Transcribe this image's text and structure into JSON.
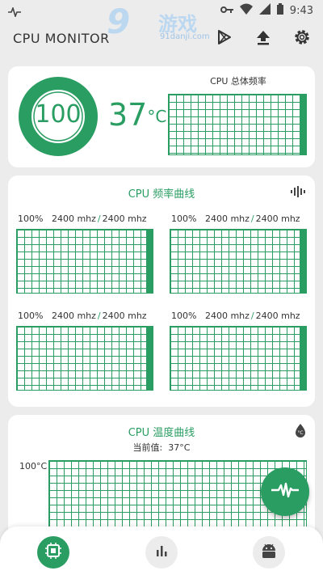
{
  "status_bar": {
    "time": "9:43",
    "icons": [
      "pulse-icon",
      "key-icon",
      "wifi-icon",
      "signal-icon",
      "battery-icon"
    ]
  },
  "app": {
    "title": "CPU MONITOR",
    "watermark": {
      "number": "9",
      "name": "游戏",
      "url": "91danji.com"
    }
  },
  "toolbar": {
    "actions": [
      "play-store-icon",
      "upload-icon",
      "settings-icon"
    ]
  },
  "overview": {
    "usage_percent": "100",
    "usage_fraction": 1.0,
    "temperature_value": "37",
    "temperature_unit": "°C",
    "total_freq_title": "CPU 总体频率",
    "total_freq_fill": 0.05
  },
  "freq_section": {
    "title": "CPU 频率曲线",
    "icon": "waveform-icon",
    "cores": [
      {
        "percent": "100%",
        "current": "2400 mhz",
        "max": "2400 mhz",
        "fill": 0.05
      },
      {
        "percent": "100%",
        "current": "2400 mhz",
        "max": "2400 mhz",
        "fill": 0.05
      },
      {
        "percent": "100%",
        "current": "2400 mhz",
        "max": "2400 mhz",
        "fill": 0.05
      },
      {
        "percent": "100%",
        "current": "2400 mhz",
        "max": "2400 mhz",
        "fill": 0.05
      }
    ]
  },
  "temp_section": {
    "title": "CPU 温度曲线",
    "icon": "thermometer-icon",
    "current_label": "当前值:",
    "current_value": "37°C",
    "y_max": "100°C"
  },
  "fab": {
    "icon": "heartbeat-icon"
  },
  "bottom_nav": {
    "items": [
      {
        "icon": "cpu-chip-icon",
        "active": true
      },
      {
        "icon": "bar-chart-icon",
        "active": false
      },
      {
        "icon": "android-icon",
        "active": false
      }
    ]
  },
  "colors": {
    "accent": "#2a9d62",
    "background": "#ececec",
    "card": "#ffffff"
  }
}
